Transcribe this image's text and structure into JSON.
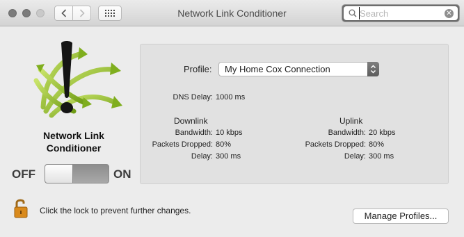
{
  "window": {
    "title": "Network Link Conditioner",
    "search_placeholder": "Search"
  },
  "app": {
    "name_line1": "Network Link",
    "name_line2": "Conditioner",
    "toggle_off_label": "OFF",
    "toggle_on_label": "ON",
    "enabled": false
  },
  "profile": {
    "label": "Profile:",
    "selected": "My Home Cox Connection",
    "dns_delay_label": "DNS Delay:",
    "dns_delay_value": "1000 ms"
  },
  "downlink": {
    "title": "Downlink",
    "bandwidth_label": "Bandwidth:",
    "bandwidth_value": "10 kbps",
    "packets_label": "Packets Dropped:",
    "packets_value": "80%",
    "delay_label": "Delay:",
    "delay_value": "300 ms"
  },
  "uplink": {
    "title": "Uplink",
    "bandwidth_label": "Bandwidth:",
    "bandwidth_value": "20 kbps",
    "packets_label": "Packets Dropped:",
    "packets_value": "80%",
    "delay_label": "Delay:",
    "delay_value": "300 ms"
  },
  "footer": {
    "lock_text": "Click the lock to prevent further changes.",
    "manage_button": "Manage Profiles..."
  },
  "colors": {
    "accent_green": "#7fae1e",
    "lock_orange": "#d98a1c"
  },
  "icons": [
    "back-icon",
    "forward-icon",
    "grid-icon",
    "search-icon",
    "clear-icon",
    "exclamation-icon",
    "lock-icon",
    "stepper-icon"
  ]
}
